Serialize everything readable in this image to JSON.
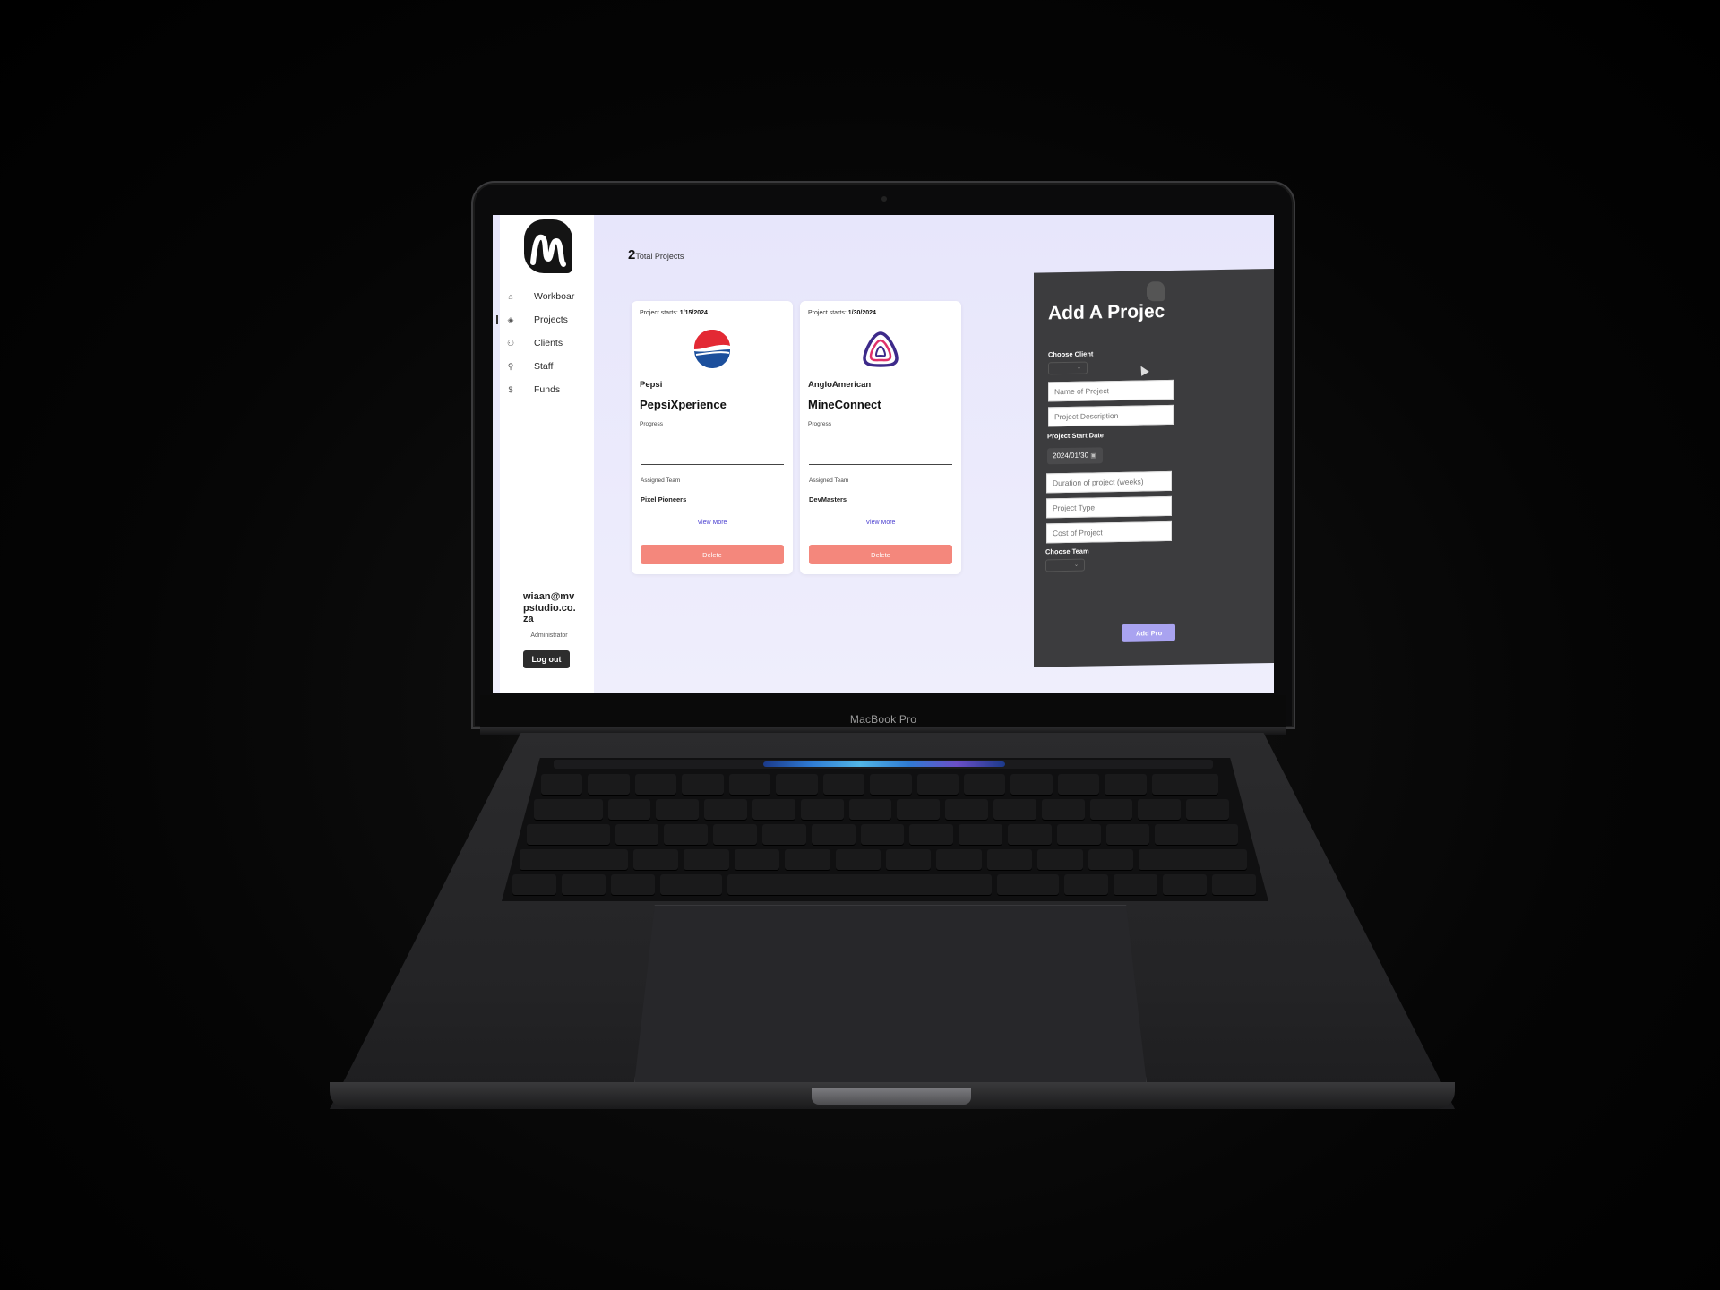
{
  "device": {
    "label": "MacBook Pro"
  },
  "app": {
    "sidebar": {
      "items": [
        {
          "label": "Workboar",
          "icon": "home-icon"
        },
        {
          "label": "Projects",
          "icon": "layers-icon"
        },
        {
          "label": "Clients",
          "icon": "users-icon"
        },
        {
          "label": "Staff",
          "icon": "user-check-icon"
        },
        {
          "label": "Funds",
          "icon": "dollar-icon"
        }
      ],
      "user_email": "wiaan@mvpstudio.co.za",
      "user_role": "Administrator",
      "logout_label": "Log out"
    },
    "summary": {
      "count": "2",
      "label": "Total Projects"
    },
    "projects": [
      {
        "starts_label": "Project starts:",
        "start_date": "1/15/2024",
        "client": "Pepsi",
        "name": "PepsiXperience",
        "progress_label": "Progress",
        "team_label": "Assigned Team",
        "team": "Pixel Pioneers",
        "view_more": "View More",
        "delete": "Delete"
      },
      {
        "starts_label": "Project starts:",
        "start_date": "1/30/2024",
        "client": "AngloAmerican",
        "name": "MineConnect",
        "progress_label": "Progress",
        "team_label": "Assigned Team",
        "team": "DevMasters",
        "view_more": "View More",
        "delete": "Delete"
      }
    ],
    "add_form": {
      "title": "Add A Projec",
      "choose_client": "Choose Client",
      "name_placeholder": "Name of Project",
      "description_placeholder": "Project Description",
      "start_date_label": "Project Start Date",
      "start_date_value": "2024/01/30",
      "duration_placeholder": "Duration of project (weeks)",
      "type_placeholder": "Project Type",
      "cost_placeholder": "Cost of Project",
      "choose_team": "Choose Team",
      "submit": "Add Pro"
    }
  },
  "colors": {
    "accent": "#4a3fd0",
    "delete": "#f4877c",
    "submit": "#a9a3f0",
    "panel": "#3c3c3e",
    "screen_bg": "#ecebfc"
  }
}
